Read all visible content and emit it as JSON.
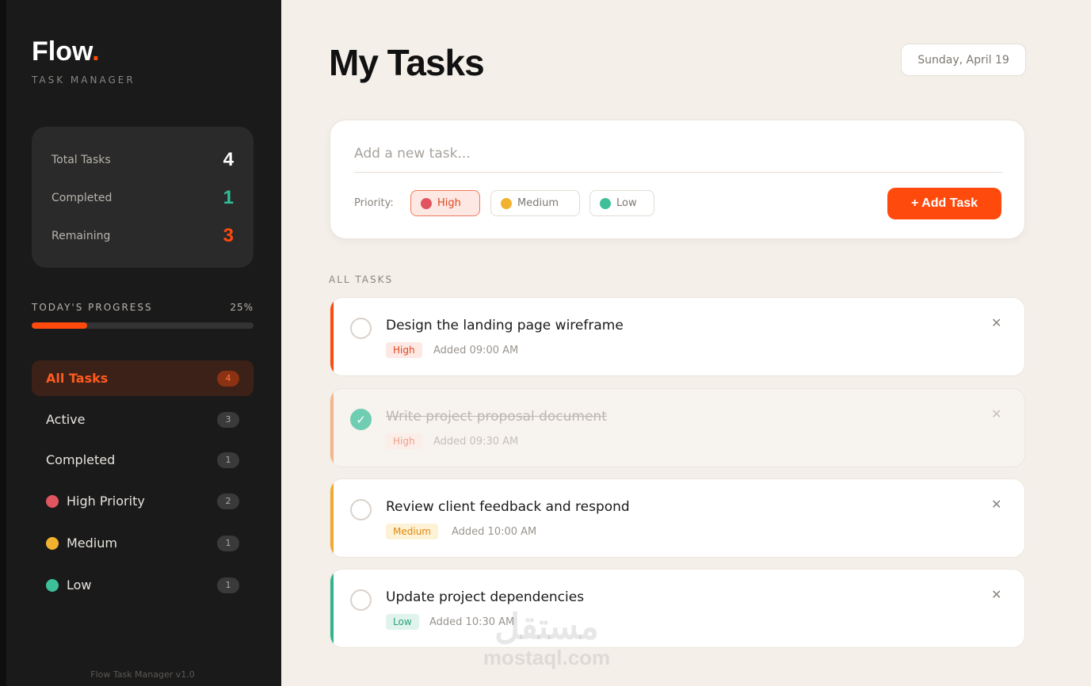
{
  "sidebar": {
    "logo": "Flow",
    "logo_dot": ".",
    "subtitle": "TASK MANAGER",
    "stats": {
      "total_label": "Total Tasks",
      "total_value": "4",
      "completed_label": "Completed",
      "completed_value": "1",
      "remaining_label": "Remaining",
      "remaining_value": "3"
    },
    "progress": {
      "label": "TODAY'S PROGRESS",
      "percent_text": "25%",
      "fraction": 0.25
    },
    "nav": [
      {
        "label": "All Tasks",
        "count": "4",
        "active": true,
        "dot": null
      },
      {
        "label": "Active",
        "count": "3",
        "active": false,
        "dot": null
      },
      {
        "label": "Completed",
        "count": "1",
        "active": false,
        "dot": null
      },
      {
        "label": "High Priority",
        "count": "2",
        "active": false,
        "dot": "#e05560"
      },
      {
        "label": "Medium",
        "count": "1",
        "active": false,
        "dot": "#f2b230"
      },
      {
        "label": "Low",
        "count": "1",
        "active": false,
        "dot": "#3dbf9a"
      }
    ],
    "footer": "Flow Task Manager v1.0"
  },
  "header": {
    "title": "My Tasks",
    "date": "Sunday, April 19"
  },
  "add_task": {
    "placeholder": "Add a new task...",
    "priority_label": "Priority:",
    "priorities": [
      {
        "label": "High",
        "color": "#e05560",
        "selected": true
      },
      {
        "label": "Medium",
        "color": "#f2b230",
        "selected": false
      },
      {
        "label": "Low",
        "color": "#3dbf9a",
        "selected": false
      }
    ],
    "button": "+ Add Task"
  },
  "section_label": "ALL TASKS",
  "tasks": [
    {
      "title": "Design the landing page wireframe",
      "priority": "High",
      "added": "Added 09:00 AM",
      "done": false,
      "color": "#ff4a0d"
    },
    {
      "title": "Write project proposal document",
      "priority": "High",
      "added": "Added 09:30 AM",
      "done": true,
      "color": "#f5b58c"
    },
    {
      "title": "Review client feedback and respond",
      "priority": "Medium",
      "added": "Added 10:00 AM",
      "done": false,
      "color": "#f2a930"
    },
    {
      "title": "Update project dependencies",
      "priority": "Low",
      "added": "Added 10:30 AM",
      "done": false,
      "color": "#2fb58e"
    }
  ],
  "colors": {
    "accent": "#ff4a0d",
    "completed": "#2fbf9a",
    "total": "#ffffff"
  },
  "watermark": {
    "arabic": "مستقل",
    "latin": "mostaql.com"
  }
}
